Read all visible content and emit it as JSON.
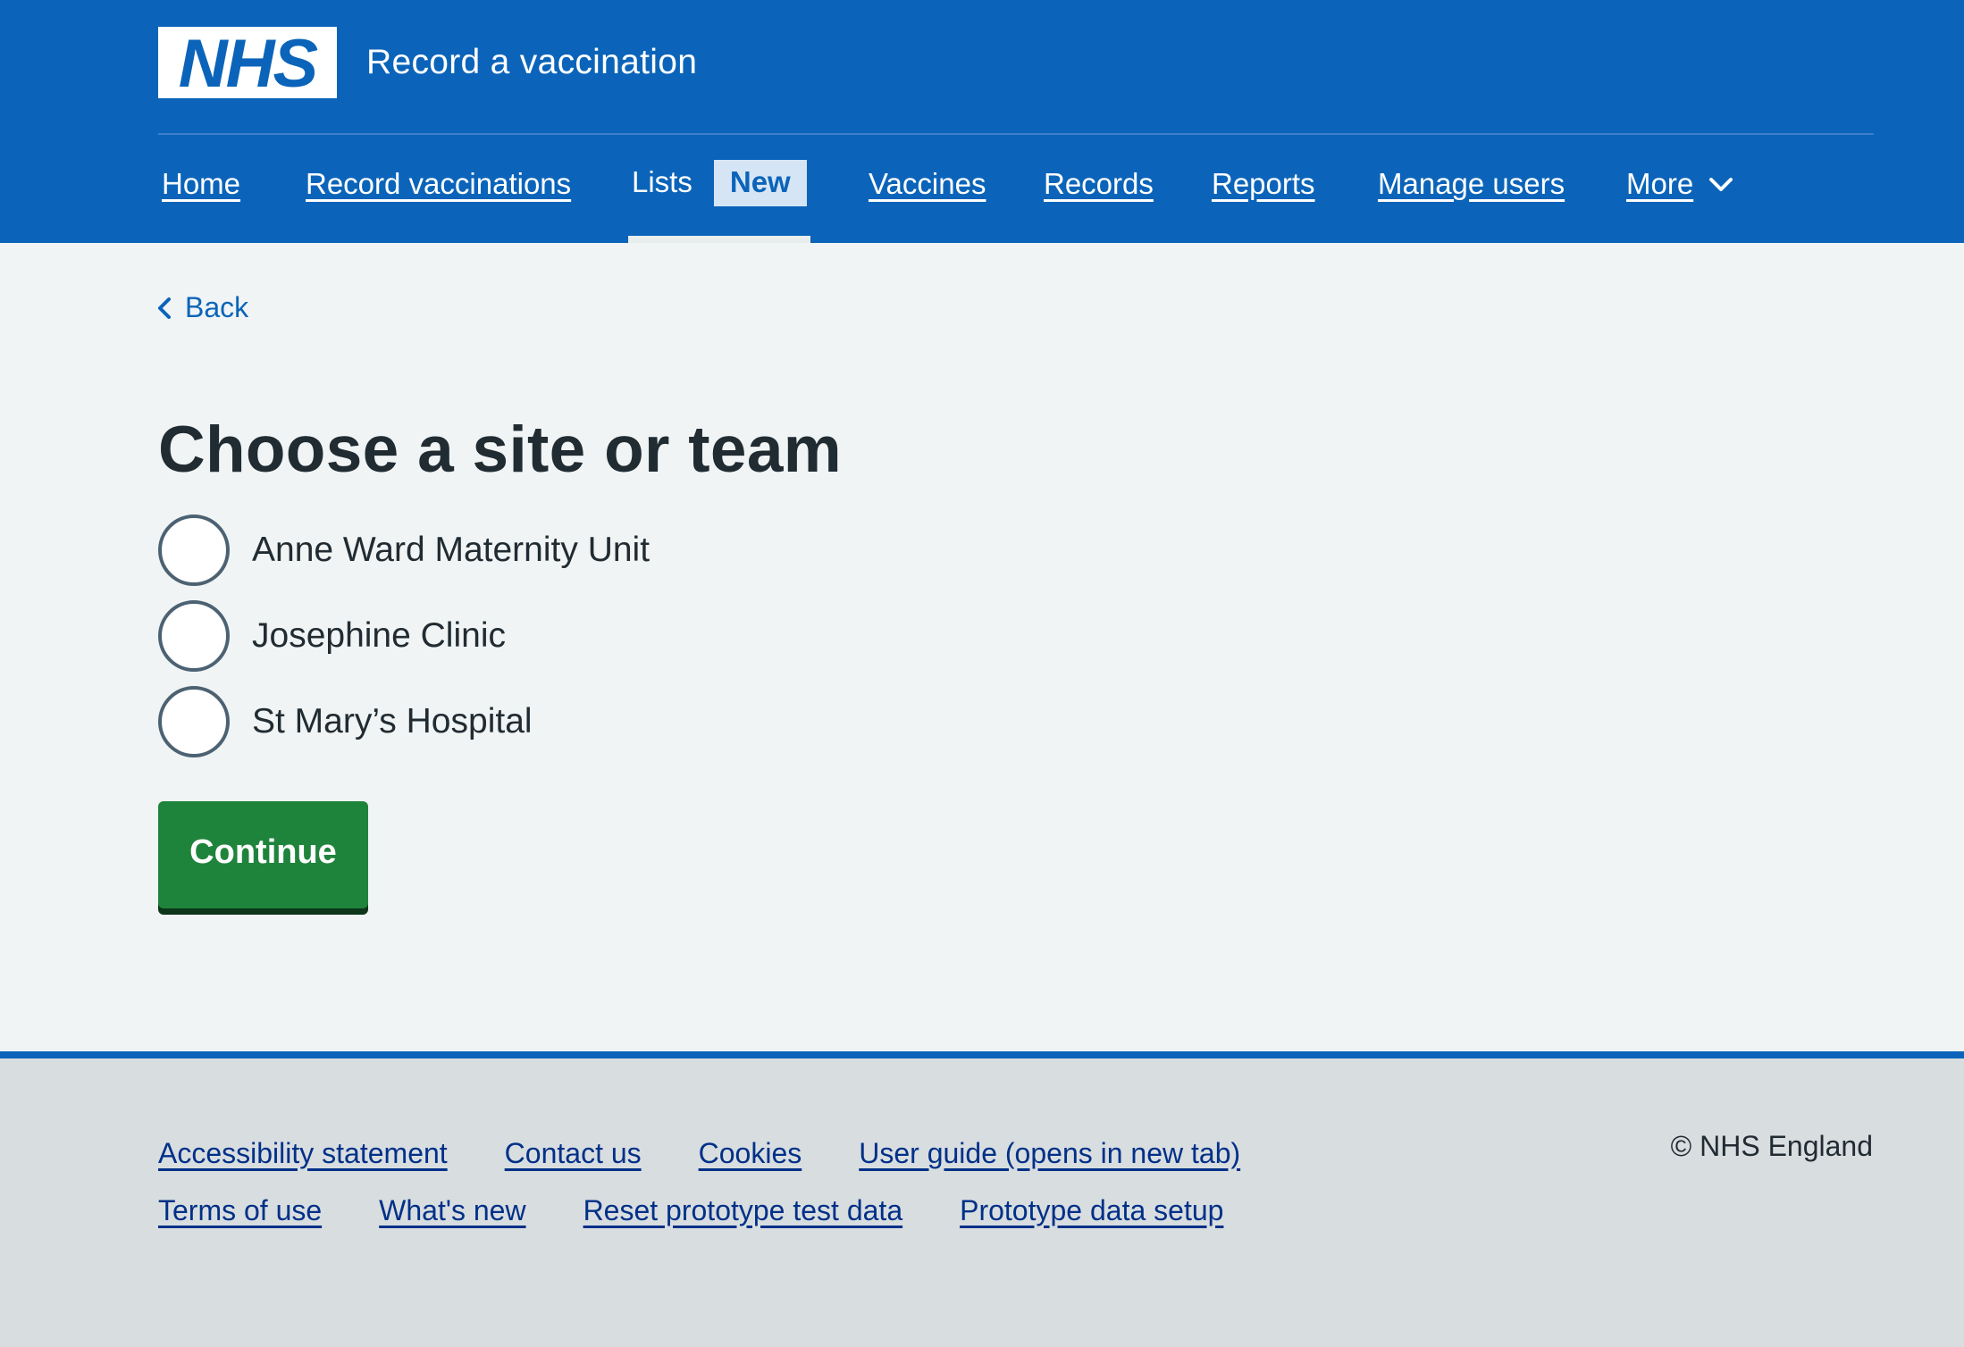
{
  "header": {
    "logo_text": "NHS",
    "service_name": "Record a vaccination",
    "brand_color": "#005eb8"
  },
  "nav": {
    "items": [
      {
        "label": "Home"
      },
      {
        "label": "Record vaccinations"
      },
      {
        "label": "Lists",
        "tag": "New",
        "current": true
      },
      {
        "label": "Vaccines"
      },
      {
        "label": "Records"
      },
      {
        "label": "Reports"
      },
      {
        "label": "Manage users"
      },
      {
        "label": "More",
        "icon": "chevron-down-icon"
      }
    ]
  },
  "back": {
    "label": "Back",
    "icon": "chevron-left-icon"
  },
  "main": {
    "title": "Choose a site or team",
    "options": [
      {
        "label": "Anne Ward Maternity Unit",
        "checked": false
      },
      {
        "label": "Josephine Clinic",
        "checked": false
      },
      {
        "label": "St Mary’s Hospital",
        "checked": false
      }
    ],
    "continue_label": "Continue"
  },
  "footer": {
    "row1": [
      {
        "label": "Accessibility statement"
      },
      {
        "label": "Contact us"
      },
      {
        "label": "Cookies"
      },
      {
        "label": "User guide (opens in new tab)"
      }
    ],
    "row2": [
      {
        "label": "Terms of use"
      },
      {
        "label": "What's new"
      },
      {
        "label": "Reset prototype test data"
      },
      {
        "label": "Prototype data setup"
      }
    ],
    "copyright": "© NHS England"
  }
}
